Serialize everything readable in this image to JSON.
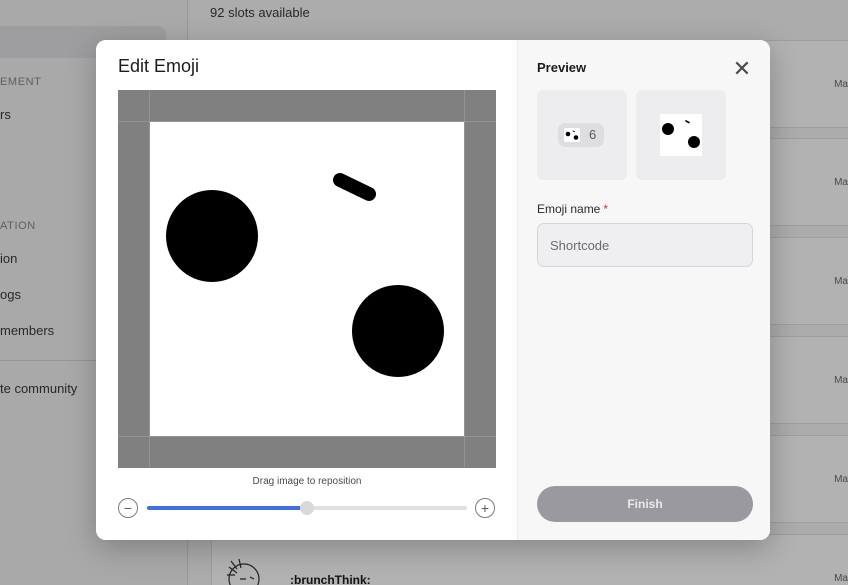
{
  "background": {
    "slots_text": "92 slots available",
    "sidebar": {
      "section_1": "EMENT",
      "section_1_items": [
        "rs"
      ],
      "section_2": "ATION",
      "section_2_items": [
        "ion",
        "ogs",
        "members"
      ],
      "bottom_item": "te community"
    },
    "rows": [
      {
        "meta": "Ma"
      },
      {
        "meta": "Ma"
      },
      {
        "meta": "Ma"
      },
      {
        "meta": "Ma"
      },
      {
        "meta": "Ma"
      }
    ],
    "last_row": {
      "shortcode": ":brunchThink:",
      "meta": "Ma"
    }
  },
  "modal": {
    "title": "Edit Emoji",
    "drag_hint": "Drag image to reposition",
    "zoom": {
      "level": 0.5,
      "minus_symbol": "−",
      "plus_symbol": "+"
    },
    "preview": {
      "label": "Preview",
      "close_symbol": "✕",
      "reaction_count": "6"
    },
    "form": {
      "name_label": "Emoji name",
      "required_mark": "*",
      "name_value": "",
      "name_placeholder": "Shortcode"
    },
    "finish_label": "Finish"
  },
  "colors": {
    "accent": "#3f6fe0",
    "required": "#d6303b",
    "crop_background": "#808080",
    "finish_disabled": "#9a9a9e"
  },
  "icons": {
    "close": "close-icon",
    "zoom_out": "minus-circle-icon",
    "zoom_in": "plus-circle-icon"
  }
}
